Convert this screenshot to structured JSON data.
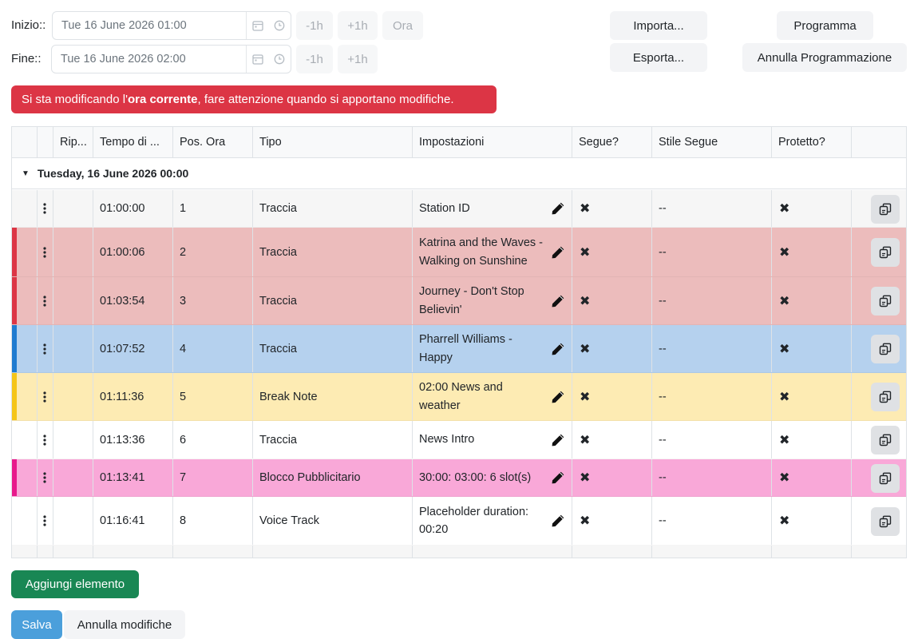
{
  "time": {
    "start_label": "Inizio::",
    "start_value": "Tue 16 June 2026 01:00",
    "end_label": "Fine::",
    "end_value": "Tue 16 June 2026 02:00",
    "minus": "-1h",
    "plus": "+1h",
    "now": "Ora"
  },
  "actions": {
    "import": "Importa...",
    "export": "Esporta...",
    "schedule": "Programma",
    "unschedule": "Annulla Programmazione"
  },
  "alert": {
    "prefix": "Si sta modificando l'",
    "bold": "ora corrente",
    "suffix": ", fare attenzione quando si apportano modifiche."
  },
  "table": {
    "headers": [
      "Rip...",
      "Tempo di ...",
      "Pos. Ora",
      "Tipo",
      "Impostazioni",
      "Segue?",
      "Stile Segue",
      "Protetto?"
    ],
    "group": "Tuesday, 16 June 2026 00:00",
    "rows": [
      {
        "time": "01:00:00",
        "pos": "1",
        "type": "Traccia",
        "settings": "Station ID",
        "follow": "✖",
        "style": "--",
        "protected": "✖",
        "color": "",
        "bg": "#f6f6f6"
      },
      {
        "time": "01:00:06",
        "pos": "2",
        "type": "Traccia",
        "settings": "Katrina and the Waves - Walking on Sunshine",
        "follow": "✖",
        "style": "--",
        "protected": "✖",
        "color": "#dc3545",
        "bg": "#ecbcbc"
      },
      {
        "time": "01:03:54",
        "pos": "3",
        "type": "Traccia",
        "settings": "Journey - Don't Stop Believin'",
        "follow": "✖",
        "style": "--",
        "protected": "✖",
        "color": "#dc3545",
        "bg": "#ecbcbc"
      },
      {
        "time": "01:07:52",
        "pos": "4",
        "type": "Traccia",
        "settings": "Pharrell Williams - Happy",
        "follow": "✖",
        "style": "--",
        "protected": "✖",
        "color": "#1f7bd0",
        "bg": "#b5d1ee"
      },
      {
        "time": "01:11:36",
        "pos": "5",
        "type": "Break Note",
        "settings": "02:00 News and weather",
        "follow": "✖",
        "style": "--",
        "protected": "✖",
        "color": "#f5c518",
        "bg": "#fdebb3"
      },
      {
        "time": "01:13:36",
        "pos": "6",
        "type": "Traccia",
        "settings": "News Intro",
        "follow": "✖",
        "style": "--",
        "protected": "✖",
        "color": "",
        "bg": "#ffffff"
      },
      {
        "time": "01:13:41",
        "pos": "7",
        "type": "Blocco Pubblicitario",
        "settings": "30:00: 03:00: 6 slot(s)",
        "follow": "✖",
        "style": "--",
        "protected": "✖",
        "color": "#e8198b",
        "bg": "#f9a8d8"
      },
      {
        "time": "01:16:41",
        "pos": "8",
        "type": "Voice Track",
        "settings": "Placeholder duration: 00:20",
        "follow": "✖",
        "style": "--",
        "protected": "✖",
        "color": "",
        "bg": "#ffffff"
      }
    ]
  },
  "footer": {
    "add": "Aggiungi elemento",
    "save": "Salva",
    "discard": "Annulla modifiche"
  },
  "icons": {
    "calendar": "calendar-icon",
    "clock": "clock-icon",
    "drag": "drag-handle-icon",
    "edit": "pencil-icon",
    "copy": "copy-icon"
  }
}
